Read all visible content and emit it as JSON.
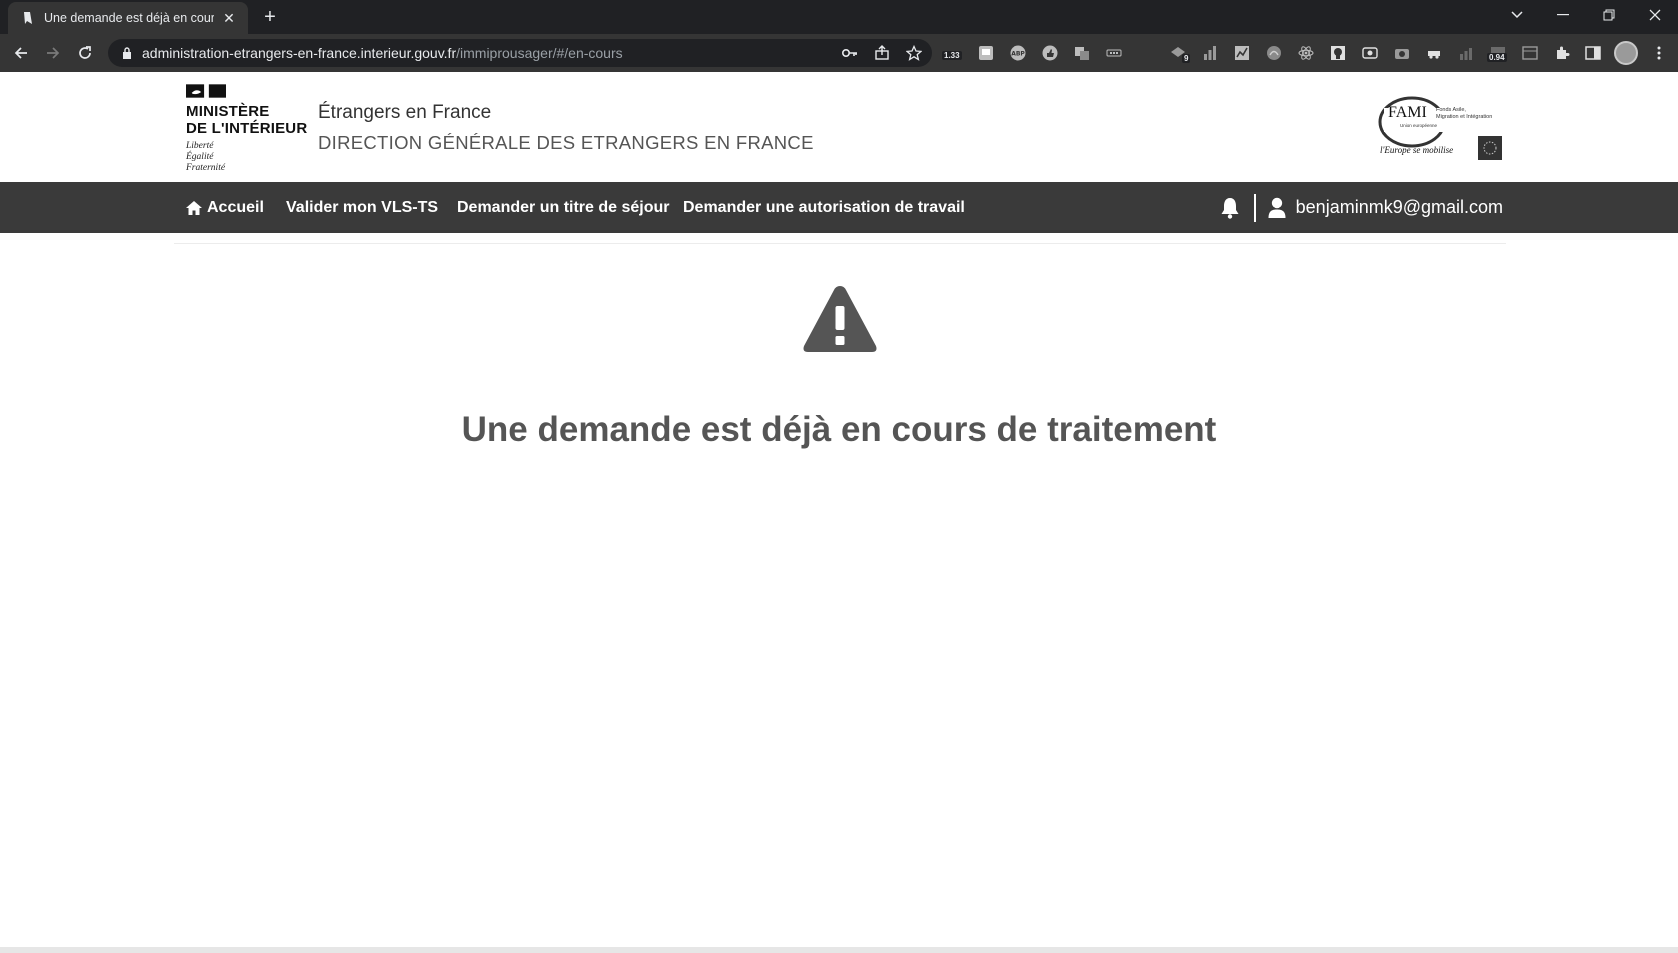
{
  "browser": {
    "tab_title": "Une demande est déjà en cours c",
    "url_host": "administration-etrangers-en-france.interieur.gouv.fr",
    "url_path": "/immiprousager/#/en-cours",
    "ext_badges": {
      "first": "1.33",
      "second": "9",
      "third": "0.94"
    }
  },
  "header": {
    "ministry_title_line1": "MINISTÈRE",
    "ministry_title_line2": "DE L'INTÉRIEUR",
    "motto_line1": "Liberté",
    "motto_line2": "Égalité",
    "motto_line3": "Fraternité",
    "site_name": "Étrangers en France",
    "site_subtitle": "DIRECTION GÉNÉRALE DES ETRANGERS EN FRANCE",
    "fami_logo": {
      "acronym": "FAMI",
      "desc_line1": "Fonds Asile,",
      "desc_line2": "Migration et Intégration",
      "union": "Union européenne",
      "slogan": "l'Europe se mobilise"
    }
  },
  "nav": {
    "home": "Accueil",
    "items": [
      "Valider mon VLS-TS",
      "Demander un titre de séjour",
      "Demander une autorisation de travail"
    ],
    "user_email": "benjaminmk9@gmail.com"
  },
  "main": {
    "message": "Une demande est déjà en cours de traitement"
  },
  "colors": {
    "nav_bg": "#3a3a3a",
    "message": "#555555",
    "chrome_dark": "#202124",
    "chrome_toolbar": "#353535"
  }
}
